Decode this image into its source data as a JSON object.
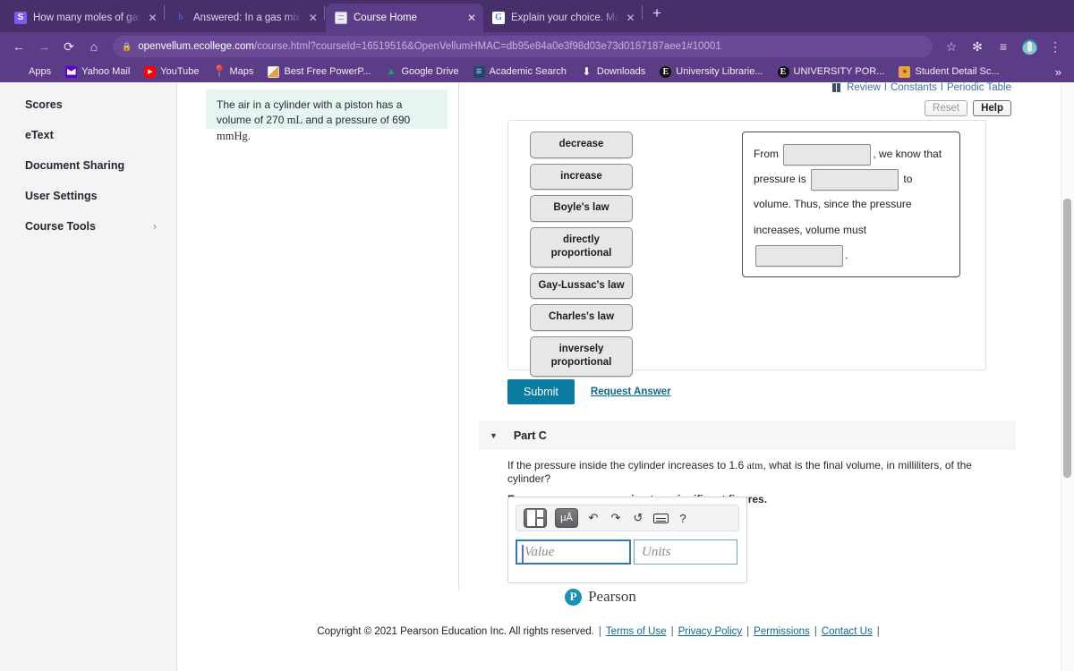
{
  "browser": {
    "tabs": [
      {
        "favicon": "stackoverflow-favicon",
        "title": "How many moles of gas are in",
        "active": false,
        "close": "✕"
      },
      {
        "favicon": "bartleby-favicon",
        "title": "Answered: In a gas mixture, the",
        "active": false,
        "close": "✕"
      },
      {
        "favicon": "course-favicon",
        "title": "Course Home",
        "active": true,
        "close": "✕"
      },
      {
        "favicon": "google-favicon",
        "title": "Explain your choice. Match the",
        "active": false,
        "close": "✕"
      }
    ],
    "new_tab_label": "+",
    "nav": {
      "back": "←",
      "forward": "→",
      "reload": "⟳",
      "home": "⌂",
      "lock": "🔒",
      "url_host": "openvellum.ecollege.com",
      "url_path": "/course.html?courseId=16519516&OpenVellumHMAC=db95e84a0e3f98d03e73d0187187aee1#10001",
      "star": "☆",
      "extensions": "🧩",
      "reading_list": "☰",
      "menu": "⋮"
    },
    "bookmarks": [
      {
        "label": "Apps",
        "icon": "apps-grid-icon"
      },
      {
        "label": "Yahoo Mail",
        "icon": "yahoo-mail-icon"
      },
      {
        "label": "YouTube",
        "icon": "youtube-icon"
      },
      {
        "label": "Maps",
        "icon": "maps-pin-icon"
      },
      {
        "label": "Best Free PowerP...",
        "icon": "powerpoint-icon"
      },
      {
        "label": "Google Drive",
        "icon": "google-drive-icon"
      },
      {
        "label": "Academic Search",
        "icon": "academic-search-icon"
      },
      {
        "label": "Downloads",
        "icon": "download-icon"
      },
      {
        "label": "University Librarie...",
        "icon": "ebsco-icon"
      },
      {
        "label": "UNIVERSITY POR...",
        "icon": "ebsco-icon"
      },
      {
        "label": "Student Detail Sc...",
        "icon": "student-detail-icon"
      }
    ],
    "bookmarks_overflow": "»"
  },
  "sidebar": {
    "items": [
      {
        "label": "Scores",
        "chevron": ""
      },
      {
        "label": "eText",
        "chevron": ""
      },
      {
        "label": "Document Sharing",
        "chevron": ""
      },
      {
        "label": "User Settings",
        "chevron": ""
      },
      {
        "label": "Course Tools",
        "chevron": "›"
      }
    ]
  },
  "toolbar": {
    "review": "Review",
    "constants": "Constants",
    "periodic_table": "Periodic Table",
    "separator": "I",
    "reset_label": "Reset",
    "help_label": "Help"
  },
  "question": {
    "intro_part1": "The air in a cylinder with a piston has a volume of",
    "intro_value1": "270",
    "intro_unit1": "mL",
    "intro_part2": " and a pressure of ",
    "intro_value2": "690",
    "intro_unit2": "mmHg",
    "intro_end": "."
  },
  "part_b": {
    "tiles": [
      "decrease",
      "increase",
      "Boyle's law",
      "directly\nproportional",
      "Gay-Lussac's law",
      "Charles's law",
      "inversely\nproportional"
    ],
    "sentence": {
      "seg1": "From",
      "slot1": "",
      "seg2": ", we know that pressure is",
      "slot2": "",
      "seg3": "to volume. Thus, since the",
      "seg4": "pressure increases, volume must",
      "slot3": "",
      "seg5": "."
    },
    "submit_label": "Submit",
    "request_answer_label": "Request Answer"
  },
  "part_c": {
    "caret": "▼",
    "label": "Part C",
    "prompt_pre": "If the pressure inside the cylinder increases to 1.6 ",
    "prompt_unit": "atm",
    "prompt_post": ", what is the final volume, in milliliters, of the cylinder?",
    "instruction": "Express your answer using two significant figures.",
    "answer_toolbar": {
      "template_icon": "math-template-icon",
      "units_label": "μÅ",
      "undo": "↶",
      "redo": "↷",
      "reset": "↺",
      "keyboard": "keyboard-icon",
      "help": "?"
    },
    "value_placeholder": "Value",
    "units_placeholder": "Units",
    "value_current": "",
    "units_current": ""
  },
  "footer": {
    "brand_mark": "P",
    "brand_name": "Pearson",
    "copyright": "Copyright © 2021 Pearson Education Inc. All rights reserved.",
    "links": [
      "Terms of Use",
      "Privacy Policy",
      "Permissions",
      "Contact Us"
    ],
    "divider": "|"
  },
  "colors": {
    "browser_chrome": "#5b3c86",
    "submit_blue": "#0a7ca0",
    "link_blue": "#0a6a8c",
    "question_bg": "#e6f4f2",
    "tile_bg": "#e7e7e7"
  }
}
